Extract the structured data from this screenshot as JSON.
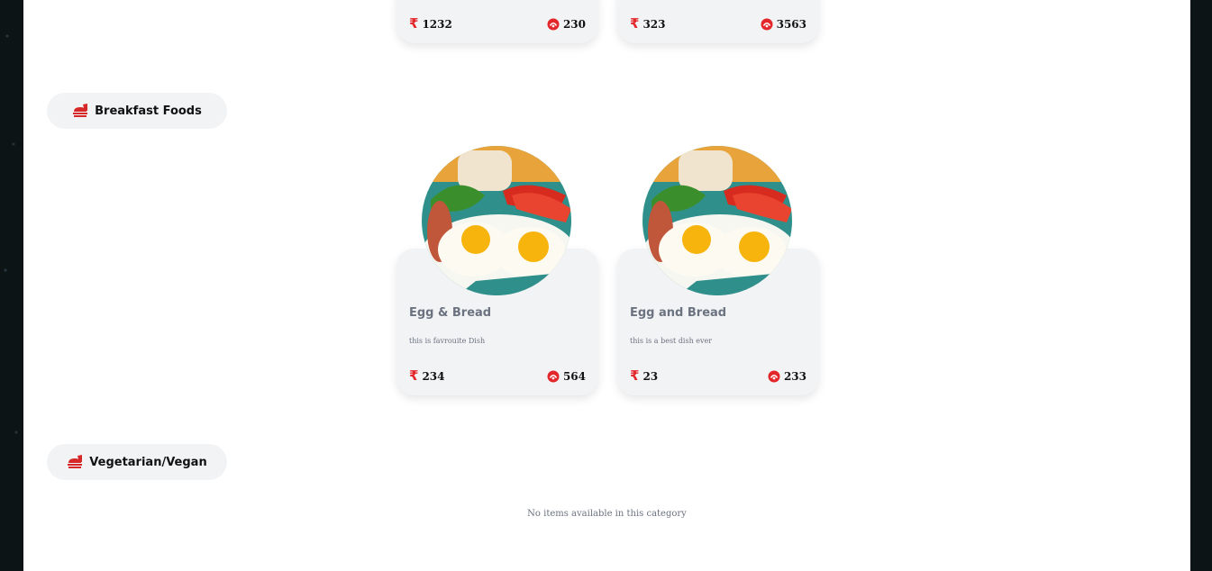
{
  "top_cards": [
    {
      "price": "1232",
      "kcal": "230"
    },
    {
      "price": "323",
      "kcal": "3563"
    }
  ],
  "categories": [
    {
      "label": "Breakfast Foods",
      "icon": "food-tray-icon"
    },
    {
      "label": "Vegetarian/Vegan",
      "icon": "food-tray-icon"
    }
  ],
  "breakfast_items": [
    {
      "title": "Egg & Bread",
      "desc": "this is favrouite Dish",
      "price": "234",
      "kcal": "564"
    },
    {
      "title": "Egg and Bread",
      "desc": "this is a best dish ever",
      "price": "23",
      "kcal": "233"
    }
  ],
  "vegetarian": {
    "empty_message": "No items available in this category"
  },
  "icons": {
    "price": "rupee-icon",
    "calories": "calorie-icon"
  },
  "colors": {
    "accent": "#e3262a",
    "card_bg": "#f2f3f5",
    "muted_text": "#6b7280"
  }
}
